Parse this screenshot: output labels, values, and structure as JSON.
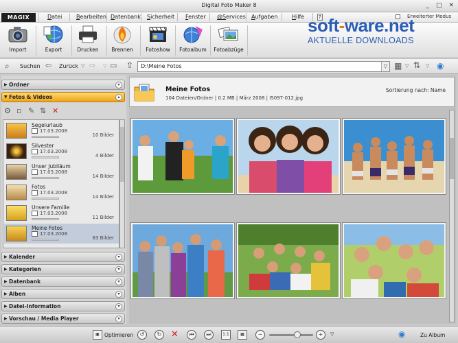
{
  "window": {
    "title": "Digital Foto Maker 8"
  },
  "menu": {
    "logo": "MAGIX",
    "items": [
      "Datei",
      "Bearbeiten",
      "Datenbank",
      "Sicherheit",
      "Fenster",
      "@Services",
      "Aufgaben",
      "Hilfe"
    ],
    "expert_mode_label": "Erweiterter Modus",
    "help_badge": "?"
  },
  "toolbar": {
    "buttons": [
      "Import",
      "Export",
      "Drucken",
      "Brennen",
      "Fotoshow",
      "Fotoalbum",
      "Fotoabzüge"
    ]
  },
  "watermark": {
    "brand_a": "soft",
    "brand_dash": "-",
    "brand_b": "ware.net",
    "tagline": "AKTUELLE DOWNLOADS"
  },
  "nav": {
    "search_label": "Suchen",
    "back_label": "Zurück",
    "path": "D:\\Meine Fotos"
  },
  "sidebar": {
    "sections_top": [
      "Ordner",
      "Fotos & Videos"
    ],
    "sections_bottom": [
      "Kalender",
      "Kategorien",
      "Datenbank",
      "Alben",
      "Datei-Information",
      "Vorschau / Media Player"
    ],
    "albums": [
      {
        "name": "Segelurlaub",
        "date": "17.03.2008",
        "count": "10 Bilder"
      },
      {
        "name": "Silvester",
        "date": "17.03.2008",
        "count": "4 Bilder"
      },
      {
        "name": "Unser Jubiläum",
        "date": "17.03.2008",
        "count": "14 Bilder"
      },
      {
        "name": "Fotos",
        "date": "17.03.2008",
        "count": "14 Bilder"
      },
      {
        "name": "Unsere Familie",
        "date": "17.03.2008",
        "count": "11 Bilder"
      },
      {
        "name": "Meine Fotos",
        "date": "17.03.2008",
        "count": "83 Bilder"
      }
    ]
  },
  "main": {
    "title": "Meine Fotos",
    "info": "104 Dateien/Ordner | 0.2 MB | März 2008 | IS097-012.jpg",
    "sort_label": "Sortierung nach: Name"
  },
  "bottom": {
    "optimize_label": "Optimieren",
    "album_label": "Zu Album"
  },
  "colors": {
    "accent": "#f0a418",
    "brand_blue": "#2a5db5",
    "brand_orange": "#e07a1a"
  }
}
